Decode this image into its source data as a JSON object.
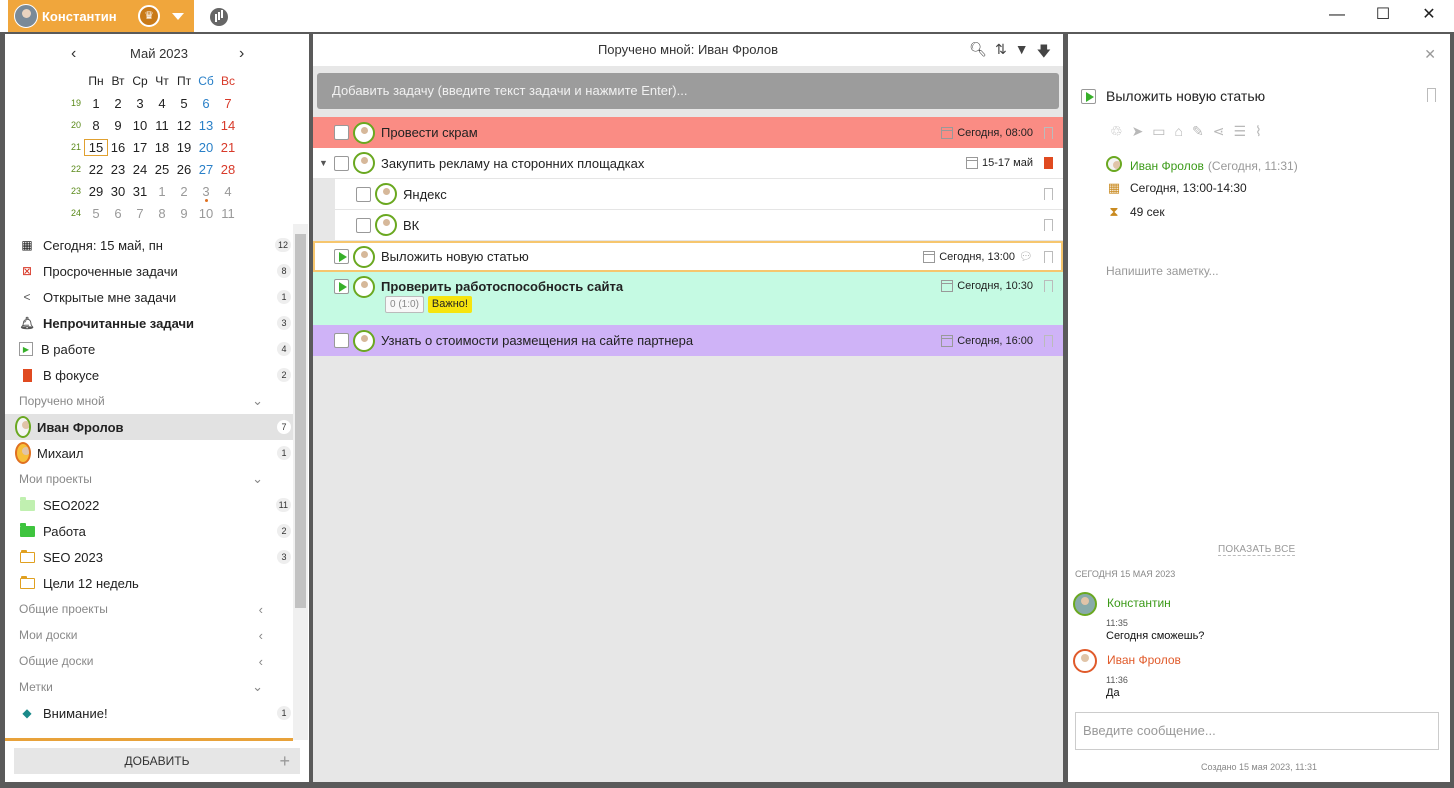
{
  "window": {
    "user_name": "Константин",
    "minimize": "—",
    "maximize": "☐",
    "close": "✕"
  },
  "calendar": {
    "month": "Май 2023",
    "prev": "‹",
    "next": "›",
    "dow": [
      "Пн",
      "Вт",
      "Ср",
      "Чт",
      "Пт",
      "Сб",
      "Вс"
    ],
    "weeks": [
      {
        "num": "19",
        "days": [
          "1",
          "2",
          "3",
          "4",
          "5",
          "6",
          "7"
        ]
      },
      {
        "num": "20",
        "days": [
          "8",
          "9",
          "10",
          "11",
          "12",
          "13",
          "14"
        ]
      },
      {
        "num": "21",
        "days": [
          "15",
          "16",
          "17",
          "18",
          "19",
          "20",
          "21"
        ]
      },
      {
        "num": "22",
        "days": [
          "22",
          "23",
          "24",
          "25",
          "26",
          "27",
          "28"
        ]
      },
      {
        "num": "23",
        "days": [
          "29",
          "30",
          "31",
          "1",
          "2",
          "3",
          "4"
        ]
      },
      {
        "num": "24",
        "days": [
          "5",
          "6",
          "7",
          "8",
          "9",
          "10",
          "11"
        ]
      }
    ],
    "today": "15"
  },
  "nav": {
    "today": {
      "label": "Сегодня: 15 май, пн",
      "count": "12"
    },
    "overdue": {
      "label": "Просроченные задачи",
      "count": "8"
    },
    "shared": {
      "label": "Открытые мне задачи",
      "count": "1"
    },
    "unread": {
      "label": "Непрочитанные задачи",
      "count": "3"
    },
    "in_work": {
      "label": "В работе",
      "count": "4"
    },
    "focus": {
      "label": "В фокусе",
      "count": "2"
    },
    "assigned_section": "Поручено мной",
    "ivan": {
      "label": "Иван Фролов",
      "count": "7"
    },
    "mikhail": {
      "label": "Михаил",
      "count": "1"
    },
    "my_projects_section": "Мои проекты",
    "seo2022": {
      "label": "SEO2022",
      "count": "11"
    },
    "rabota": {
      "label": "Работа",
      "count": "2"
    },
    "seo2023": {
      "label": "SEO 2023",
      "count": "3"
    },
    "goals": {
      "label": "Цели 12 недель"
    },
    "common_projects": "Общие проекты",
    "my_boards": "Мои доски",
    "common_boards": "Общие доски",
    "labels_section": "Метки",
    "attention": {
      "label": "Внимание!",
      "count": "1"
    },
    "add_button": "ДОБАВИТЬ"
  },
  "middle": {
    "title": "Поручено мной: Иван Фролов",
    "add_placeholder": "Добавить задачу (введите текст задачи и нажмите Enter)...",
    "tasks": [
      {
        "title": "Провести скрам",
        "due": "Сегодня, 08:00"
      },
      {
        "title": "Закупить рекламу на сторонних площадках",
        "due": "15-17 май"
      },
      {
        "title": "Яндекс"
      },
      {
        "title": "ВК"
      },
      {
        "title": "Выложить новую статью",
        "due": "Сегодня, 13:00"
      },
      {
        "title": "Проверить работоспособность сайта",
        "due": "Сегодня, 10:30",
        "progress": "0 (1:0)",
        "tag": "Важно!"
      },
      {
        "title": "Узнать о стоимости размещения на сайте партнера",
        "due": "Сегодня, 16:00"
      }
    ],
    "colors": {
      "red": "#fa8c84",
      "mint": "#c5fae3",
      "purple": "#cfb3f7",
      "selected_border": "#f6c66e"
    }
  },
  "detail": {
    "title": "Выложить новую статью",
    "assignee": "Иван Фролов",
    "assigned_at": "(Сегодня, 11:31)",
    "schedule": "Сегодня, 13:00-14:30",
    "duration": "49 сек",
    "note_placeholder": "Напишите заметку...",
    "show_all": "ПОКАЗАТЬ ВСЕ",
    "day_label": "СЕГОДНЯ 15 МАЯ 2023",
    "messages": [
      {
        "author": "Константин",
        "time": "11:35",
        "text": "Сегодня сможешь?"
      },
      {
        "author": "Иван Фролов",
        "time": "11:36",
        "text": "Да"
      }
    ],
    "input_placeholder": "Введите сообщение...",
    "created": "Создано 15 мая 2023, 11:31"
  }
}
